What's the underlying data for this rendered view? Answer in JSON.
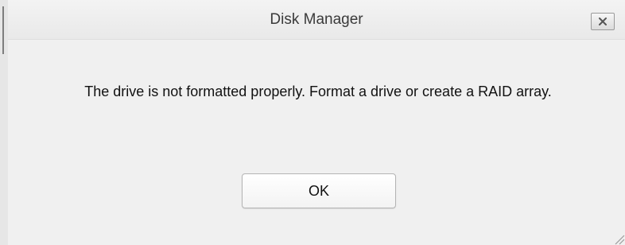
{
  "dialog": {
    "title": "Disk Manager",
    "close_icon": "close-icon",
    "message": "The drive is not formatted properly. Format a drive or create a RAID array.",
    "ok_label": "OK"
  }
}
